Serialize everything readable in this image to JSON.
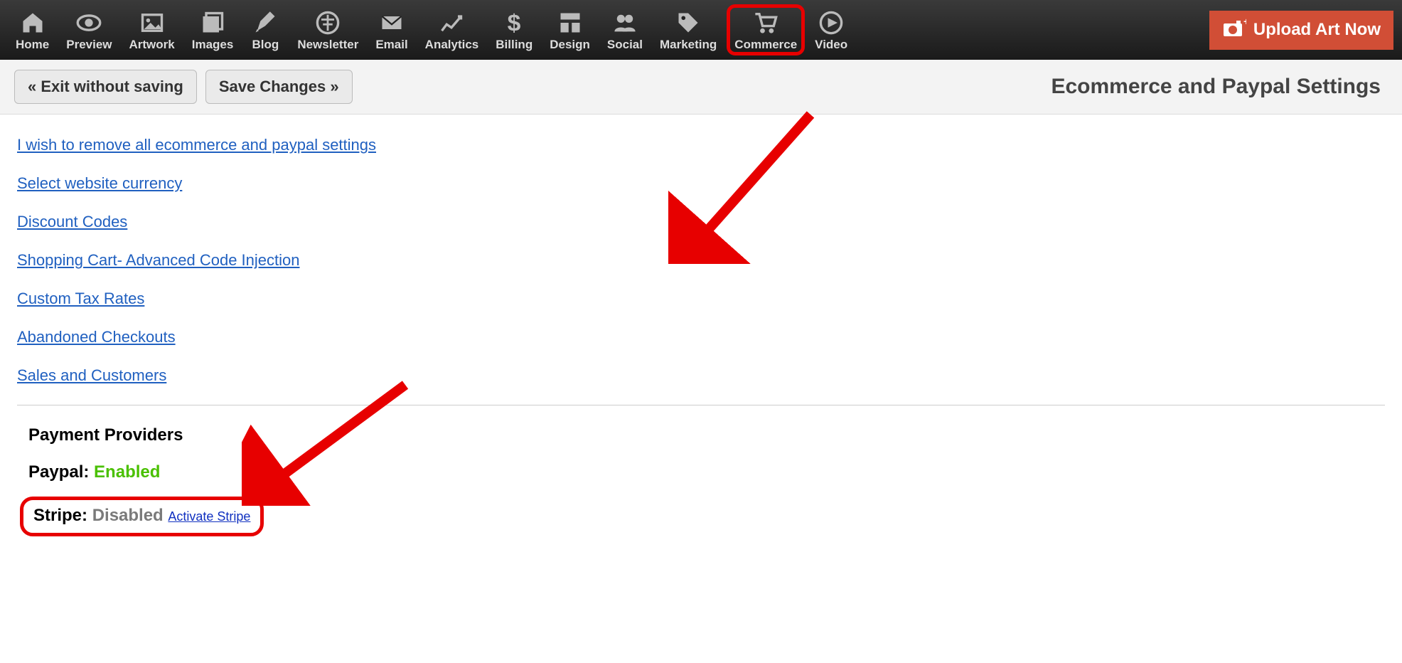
{
  "nav": {
    "items": [
      {
        "label": "Home",
        "icon": "home"
      },
      {
        "label": "Preview",
        "icon": "eye"
      },
      {
        "label": "Artwork",
        "icon": "picture"
      },
      {
        "label": "Images",
        "icon": "images"
      },
      {
        "label": "Blog",
        "icon": "pen"
      },
      {
        "label": "Newsletter",
        "icon": "dragonfly"
      },
      {
        "label": "Email",
        "icon": "envelope"
      },
      {
        "label": "Analytics",
        "icon": "chart"
      },
      {
        "label": "Billing",
        "icon": "dollar"
      },
      {
        "label": "Design",
        "icon": "layout"
      },
      {
        "label": "Social",
        "icon": "people"
      },
      {
        "label": "Marketing",
        "icon": "tags"
      },
      {
        "label": "Commerce",
        "icon": "cart",
        "highlighted": true
      },
      {
        "label": "Video",
        "icon": "play"
      }
    ],
    "upload_label": "Upload Art Now"
  },
  "subheader": {
    "exit_label": "« Exit without saving",
    "save_label": "Save Changes »",
    "page_title": "Ecommerce and Paypal Settings"
  },
  "links": [
    "I wish to remove all ecommerce and paypal settings",
    "Select website currency",
    "Discount Codes",
    "Shopping Cart- Advanced Code Injection",
    "Custom Tax Rates",
    "Abandoned Checkouts",
    "Sales and Customers"
  ],
  "payment": {
    "section_title": "Payment Providers",
    "paypal_label": "Paypal:",
    "paypal_status": "Enabled",
    "stripe_label": "Stripe:",
    "stripe_status": "Disabled",
    "activate_stripe": "Activate Stripe"
  }
}
